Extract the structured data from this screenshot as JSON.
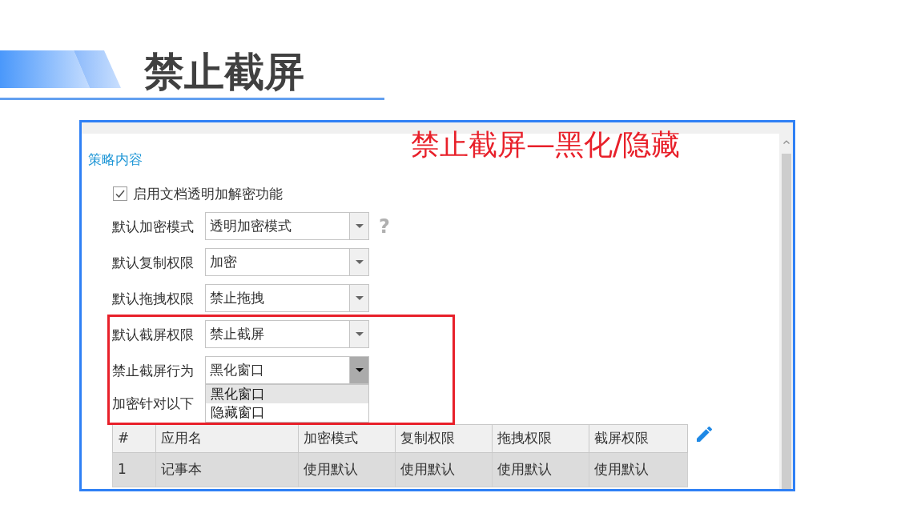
{
  "slide": {
    "title": "禁止截屏"
  },
  "annotation": {
    "text": "禁止截屏—黑化/隐藏"
  },
  "window": {
    "section_title": "策略内容",
    "enable_checkbox": {
      "label": "启用文档透明加解密功能",
      "checked": true
    },
    "fields": [
      {
        "label": "默认加密模式",
        "value": "透明加密模式",
        "open": false,
        "help": "?"
      },
      {
        "label": "默认复制权限",
        "value": "加密",
        "open": false
      },
      {
        "label": "默认拖拽权限",
        "value": "禁止拖拽",
        "open": false
      },
      {
        "label": "默认截屏权限",
        "value": "禁止截屏",
        "open": false
      },
      {
        "label": "禁止截屏行为",
        "value": "黑化窗口",
        "open": true,
        "options": [
          {
            "label": "黑化窗口",
            "selected": true
          },
          {
            "label": "隐藏窗口",
            "selected": false
          }
        ]
      }
    ],
    "table_caption": "加密针对以下",
    "table": {
      "columns": [
        "#",
        "应用名",
        "加密模式",
        "复制权限",
        "拖拽权限",
        "截屏权限"
      ],
      "rows": [
        {
          "cells": [
            "1",
            "记事本",
            "使用默认",
            "使用默认",
            "使用默认",
            "使用默认"
          ],
          "selected": true
        }
      ]
    }
  }
}
